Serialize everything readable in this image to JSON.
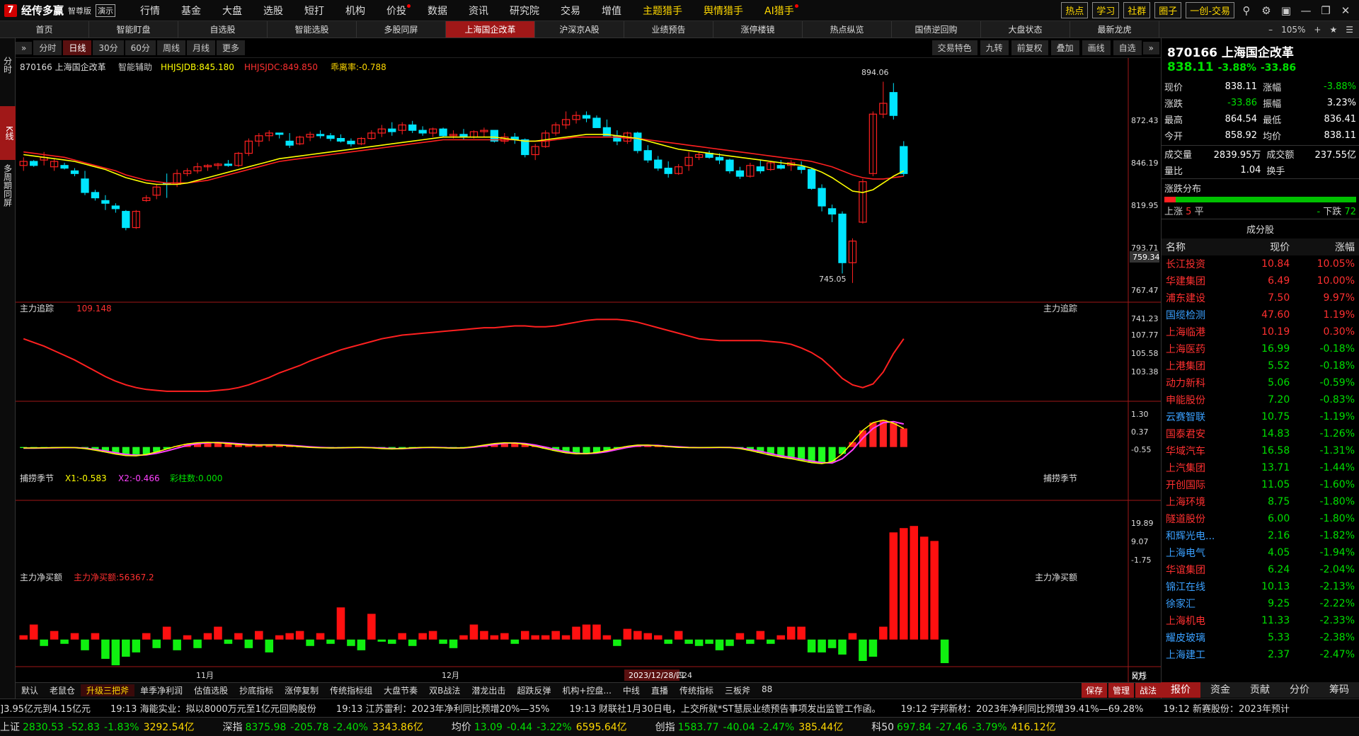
{
  "app": {
    "logo_text": "经传多赢",
    "edition": "智尊版",
    "demo_label": "演示",
    "logo_glyph": "7"
  },
  "menu": [
    {
      "label": "行情"
    },
    {
      "label": "基金"
    },
    {
      "label": "大盘"
    },
    {
      "label": "选股"
    },
    {
      "label": "短打"
    },
    {
      "label": "机构"
    },
    {
      "label": "价投",
      "dot": true
    },
    {
      "label": "数据"
    },
    {
      "label": "资讯"
    },
    {
      "label": "研究院"
    },
    {
      "label": "交易"
    },
    {
      "label": "增值"
    },
    {
      "label": "主题猎手",
      "hl": true
    },
    {
      "label": "舆情猎手",
      "hl": true
    },
    {
      "label": "AI猎手",
      "hl": true,
      "dot": true
    }
  ],
  "top_right": {
    "buttons": [
      "热点",
      "学习",
      "社群",
      "圈子",
      "一创-交易"
    ]
  },
  "tabs": [
    "首页",
    "智能盯盘",
    "自选股",
    "智能选股",
    "多股同屏",
    "上海国企改革",
    "沪深京A股",
    "业绩预告",
    "涨停楼镜",
    "热点纵览",
    "国债逆回购",
    "大盘状态",
    "最新龙虎"
  ],
  "tabs_active": "上海国企改革",
  "tabs_right": {
    "zoom": "105%"
  },
  "side_tabs": [
    "分时",
    "K线",
    "多周期同屏"
  ],
  "period_buttons": [
    "分时",
    "日线",
    "30分",
    "60分",
    "周线",
    "月线",
    "更多"
  ],
  "period_active": "日线",
  "toolbar_right": [
    "交易特色",
    "九转",
    "前复权",
    "叠加",
    "画线",
    "自选"
  ],
  "main_chart": {
    "title": "870166 上海国企改革",
    "assist": "智能辅助",
    "ind1": "HHJSJDB:845.180",
    "ind2": "HHJSJDC:849.850",
    "ind3": "乖离率:-0.788",
    "hi_label": "894.06",
    "lo_label": "745.05",
    "price_tag": "759.34",
    "yticks": [
      "872.43",
      "846.19",
      "819.95",
      "793.71",
      "767.47",
      "741.23"
    ],
    "xlabels": [
      "11月",
      "12月"
    ],
    "date_tag": "2023/12/28/四",
    "date_tail": "24",
    "period_label": "日线"
  },
  "sub1": {
    "title": "主力追踪",
    "value": "109.148",
    "right_title": "主力追踪",
    "yticks": [
      "107.77",
      "105.58",
      "103.38"
    ]
  },
  "sub2": {
    "title": "捕捞季节",
    "x1": "X1:-0.583",
    "x2": "X2:-0.466",
    "bar": "彩柱数:0.000",
    "right_title": "捕捞季节",
    "yticks": [
      "1.30",
      "0.37",
      "-0.55"
    ]
  },
  "sub3": {
    "title": "主力净买额",
    "value": "主力净买额:56367.2",
    "right_title": "主力净买额",
    "yticks": [
      "19.89",
      "9.07",
      "-1.75"
    ],
    "unit": "X万"
  },
  "chart_data": {
    "type": "candlestick",
    "ylim": [
      736,
      900
    ],
    "ohlc": [
      [
        832,
        838,
        828,
        835
      ],
      [
        835,
        836,
        831,
        832
      ],
      [
        836,
        842,
        832,
        838
      ],
      [
        831,
        837,
        828,
        835
      ],
      [
        832,
        834,
        829,
        830
      ],
      [
        828,
        830,
        824,
        826
      ],
      [
        822,
        828,
        810,
        812
      ],
      [
        812,
        814,
        806,
        808
      ],
      [
        806,
        810,
        799,
        804
      ],
      [
        802,
        804,
        797,
        800
      ],
      [
        798,
        799,
        784,
        786
      ],
      [
        786,
        799,
        785,
        798
      ],
      [
        806,
        810,
        805,
        808
      ],
      [
        810,
        818,
        807,
        816
      ],
      [
        819,
        826,
        808,
        818
      ],
      [
        818,
        829,
        816,
        826
      ],
      [
        826,
        830,
        824,
        828
      ],
      [
        828,
        834,
        826,
        831
      ],
      [
        831,
        833,
        828,
        832
      ],
      [
        832,
        834,
        829,
        833
      ],
      [
        833,
        836,
        831,
        832
      ],
      [
        832,
        842,
        831,
        841
      ],
      [
        841,
        852,
        839,
        850
      ],
      [
        850,
        856,
        846,
        854
      ],
      [
        854,
        858,
        850,
        856
      ],
      [
        856,
        856,
        852,
        855
      ],
      [
        850,
        856,
        845,
        847
      ],
      [
        848,
        854,
        847,
        853
      ],
      [
        853,
        857,
        850,
        855
      ],
      [
        855,
        858,
        852,
        854
      ],
      [
        854,
        856,
        850,
        852
      ],
      [
        852,
        855,
        849,
        850
      ],
      [
        850,
        852,
        846,
        848
      ],
      [
        848,
        853,
        847,
        852
      ],
      [
        852,
        858,
        851,
        856
      ],
      [
        856,
        862,
        853,
        859
      ],
      [
        859,
        864,
        854,
        857
      ],
      [
        858,
        864,
        855,
        862
      ],
      [
        862,
        865,
        856,
        858
      ],
      [
        858,
        861,
        854,
        856
      ],
      [
        856,
        860,
        853,
        859
      ],
      [
        859,
        860,
        853,
        854
      ],
      [
        854,
        858,
        852,
        855
      ],
      [
        855,
        859,
        851,
        853
      ],
      [
        853,
        858,
        852,
        857
      ],
      [
        857,
        860,
        853,
        858
      ],
      [
        858,
        850,
        849,
        850
      ],
      [
        850,
        856,
        848,
        853
      ],
      [
        853,
        856,
        848,
        851
      ],
      [
        851,
        852,
        838,
        840
      ],
      [
        840,
        848,
        836,
        846
      ],
      [
        846,
        858,
        845,
        856
      ],
      [
        856,
        864,
        854,
        862
      ],
      [
        862,
        872,
        859,
        866
      ],
      [
        866,
        872,
        863,
        869
      ],
      [
        869,
        872,
        864,
        867
      ],
      [
        867,
        869,
        862,
        860
      ],
      [
        860,
        866,
        856,
        854
      ],
      [
        854,
        858,
        847,
        850
      ],
      [
        850,
        857,
        848,
        856
      ],
      [
        856,
        857,
        841,
        843
      ],
      [
        843,
        847,
        834,
        836
      ],
      [
        836,
        839,
        828,
        830
      ],
      [
        830,
        835,
        823,
        826
      ],
      [
        826,
        833,
        825,
        831
      ],
      [
        832,
        842,
        828,
        838
      ],
      [
        838,
        842,
        836,
        840
      ],
      [
        841,
        843,
        837,
        838
      ],
      [
        838,
        841,
        833,
        836
      ],
      [
        836,
        837,
        826,
        828
      ],
      [
        828,
        831,
        822,
        824
      ],
      [
        824,
        834,
        823,
        832
      ],
      [
        831,
        836,
        826,
        828
      ],
      [
        829,
        835,
        828,
        834
      ],
      [
        832,
        836,
        829,
        830
      ],
      [
        832,
        836,
        828,
        834
      ],
      [
        831,
        835,
        826,
        829
      ],
      [
        829,
        830,
        814,
        815
      ],
      [
        815,
        818,
        798,
        802
      ],
      [
        800,
        803,
        790,
        796
      ],
      [
        796,
        798,
        752,
        760
      ],
      [
        760,
        778,
        745,
        776
      ],
      [
        790,
        822,
        789,
        820
      ],
      [
        826,
        872,
        824,
        870
      ],
      [
        870,
        894,
        867,
        878
      ],
      [
        886,
        893,
        866,
        869
      ],
      [
        846,
        850,
        824,
        826
      ]
    ],
    "ma_yellow": [
      840,
      839,
      838,
      837,
      836,
      835,
      833,
      831,
      829,
      826,
      823,
      821,
      819,
      818,
      818,
      818,
      819,
      821,
      823,
      825,
      827,
      829,
      831,
      833,
      835,
      837,
      838,
      839,
      840,
      841,
      842,
      843,
      844,
      845,
      846,
      847,
      848,
      849,
      850,
      851,
      852,
      853,
      853,
      853,
      853,
      853,
      853,
      852,
      851,
      850,
      850,
      851,
      852,
      853,
      854,
      855,
      855,
      855,
      854,
      853,
      852,
      850,
      848,
      846,
      844,
      843,
      842,
      841,
      840,
      839,
      838,
      837,
      836,
      835,
      834,
      833,
      832,
      830,
      827,
      823,
      818,
      813,
      812,
      814,
      819,
      824,
      828
    ],
    "ma_red": [
      842,
      841,
      840,
      839,
      838,
      836,
      834,
      832,
      830,
      828,
      825,
      823,
      821,
      820,
      819,
      819,
      819,
      820,
      821,
      823,
      825,
      827,
      829,
      831,
      833,
      835,
      836,
      837,
      838,
      839,
      840,
      841,
      842,
      843,
      844,
      845,
      846,
      847,
      848,
      849,
      850,
      851,
      851,
      851,
      851,
      851,
      851,
      851,
      851,
      850,
      850,
      850,
      851,
      852,
      853,
      853,
      853,
      853,
      853,
      852,
      852,
      851,
      850,
      849,
      848,
      847,
      846,
      845,
      844,
      843,
      842,
      841,
      840,
      839,
      838,
      837,
      836,
      835,
      833,
      831,
      828,
      825,
      823,
      822,
      822,
      823,
      824
    ],
    "zhuli_ylim": [
      101.5,
      109.8
    ],
    "zhuli": [
      107.9,
      107.5,
      107.1,
      106.6,
      106.1,
      105.6,
      105.0,
      104.4,
      103.8,
      103.3,
      102.9,
      102.6,
      102.4,
      102.3,
      102.2,
      102.2,
      102.2,
      102.2,
      102.2,
      102.3,
      102.4,
      102.6,
      102.9,
      103.3,
      103.7,
      104.2,
      104.6,
      105.0,
      105.5,
      105.9,
      106.3,
      106.7,
      107.0,
      107.3,
      107.6,
      107.9,
      108.1,
      108.3,
      108.4,
      108.5,
      108.6,
      108.7,
      108.8,
      108.9,
      109.0,
      109.1,
      109.1,
      109.2,
      109.3,
      109.3,
      109.2,
      109.2,
      109.3,
      109.5,
      109.7,
      109.9,
      110.0,
      110.0,
      110.0,
      109.9,
      109.7,
      109.4,
      109.1,
      108.8,
      108.5,
      108.2,
      107.9,
      107.8,
      107.7,
      107.7,
      107.7,
      107.7,
      107.7,
      107.6,
      107.5,
      107.3,
      106.9,
      106.4,
      105.7,
      104.7,
      103.6,
      102.9,
      102.6,
      103.0,
      104.3,
      106.3,
      107.9
    ],
    "buolao_ylim": [
      -1.1,
      1.8
    ],
    "buolao_x1": [
      -0.05,
      -0.05,
      -0.04,
      -0.03,
      -0.02,
      -0.03,
      -0.08,
      -0.16,
      -0.26,
      -0.36,
      -0.44,
      -0.45,
      -0.38,
      -0.25,
      -0.1,
      0.05,
      0.16,
      0.22,
      0.24,
      0.22,
      0.18,
      0.13,
      0.1,
      0.1,
      0.11,
      0.1,
      0.06,
      0.02,
      -0.02,
      -0.04,
      -0.05,
      -0.04,
      -0.02,
      -0.02,
      -0.04,
      -0.08,
      -0.1,
      -0.08,
      -0.04,
      -0.02,
      -0.02,
      -0.04,
      -0.06,
      -0.04,
      0.02,
      0.1,
      0.18,
      0.22,
      0.2,
      0.14,
      0.04,
      -0.08,
      -0.2,
      -0.3,
      -0.35,
      -0.34,
      -0.28,
      -0.18,
      -0.06,
      0.04,
      0.1,
      0.1,
      0.06,
      0.02,
      -0.02,
      -0.03,
      -0.03,
      -0.02,
      -0.02,
      -0.03,
      -0.08,
      -0.18,
      -0.3,
      -0.42,
      -0.52,
      -0.6,
      -0.7,
      -0.8,
      -0.85,
      -0.75,
      -0.35,
      0.25,
      0.85,
      1.25,
      1.38,
      1.22,
      0.95
    ],
    "buolao_x2": [
      -0.06,
      -0.06,
      -0.05,
      -0.04,
      -0.03,
      -0.03,
      -0.06,
      -0.12,
      -0.2,
      -0.3,
      -0.38,
      -0.42,
      -0.4,
      -0.32,
      -0.2,
      -0.06,
      0.08,
      0.17,
      0.22,
      0.23,
      0.21,
      0.17,
      0.13,
      0.11,
      0.11,
      0.11,
      0.09,
      0.05,
      0.01,
      -0.02,
      -0.04,
      -0.04,
      -0.03,
      -0.02,
      -0.03,
      -0.05,
      -0.08,
      -0.08,
      -0.06,
      -0.03,
      -0.02,
      -0.03,
      -0.05,
      -0.05,
      -0.01,
      0.05,
      0.13,
      0.19,
      0.21,
      0.18,
      0.1,
      -0.01,
      -0.13,
      -0.24,
      -0.32,
      -0.34,
      -0.31,
      -0.24,
      -0.13,
      -0.02,
      0.06,
      0.09,
      0.08,
      0.04,
      0.01,
      -0.02,
      -0.03,
      -0.03,
      -0.02,
      -0.02,
      -0.05,
      -0.12,
      -0.22,
      -0.34,
      -0.45,
      -0.53,
      -0.62,
      -0.72,
      -0.8,
      -0.82,
      -0.6,
      -0.15,
      0.45,
      0.95,
      1.25,
      1.3,
      1.18
    ],
    "jinmai_ylim": [
      -5,
      30
    ],
    "jinmai": [
      1,
      3.5,
      -1.5,
      2,
      -1,
      1.5,
      -2.5,
      1.5,
      -4.5,
      -6,
      -4,
      -3,
      1.5,
      -2,
      3,
      -2.5,
      1,
      -2,
      1.5,
      3,
      -1,
      1.5,
      -2,
      2,
      -3,
      1,
      1.5,
      2,
      -1.5,
      1.5,
      -1,
      7.5,
      -1.5,
      -2.5,
      6,
      -0.5,
      -1,
      1.5,
      -1.5,
      1.5,
      2,
      -1,
      -2,
      1,
      3.5,
      2,
      1,
      1.5,
      -1,
      2,
      1,
      1,
      2,
      1,
      3,
      3.5,
      3.5,
      1,
      -1.5,
      2.5,
      2,
      1.5,
      1,
      -1,
      2,
      -1,
      -1.5,
      -1,
      -2.5,
      -1.5,
      1.5,
      -1,
      2,
      -1,
      1,
      3,
      3,
      -3,
      -3,
      -2,
      -3.5,
      1.5,
      -5,
      -4,
      3,
      25,
      26,
      26.5,
      24,
      23,
      -5.5
    ]
  },
  "stock": {
    "title": "870166 上海国企改革",
    "price": "838.11",
    "chg_pct": "-3.88%",
    "chg": "-33.86",
    "rows": [
      [
        "现价",
        "838.11",
        "涨幅",
        "-3.88%"
      ],
      [
        "涨跌",
        "-33.86",
        "振幅",
        "3.23%"
      ],
      [
        "最高",
        "864.54",
        "最低",
        "836.41"
      ],
      [
        "今开",
        "858.92",
        "均价",
        "838.11"
      ]
    ],
    "rows2": [
      [
        "成交量",
        "2839.95万",
        "成交额",
        "237.55亿"
      ],
      [
        "量比",
        "1.04",
        "换手",
        ""
      ]
    ]
  },
  "dist": {
    "title": "涨跌分布",
    "up_label": "上涨",
    "up": "5",
    "flat_label": "平",
    "flat": "-",
    "down_label": "下跌",
    "down": "72"
  },
  "constituents": {
    "title": "成分股",
    "headers": [
      "名称",
      "现价",
      "涨幅"
    ],
    "rows": [
      [
        "长江投资",
        "10.84",
        "10.05%"
      ],
      [
        "华建集团",
        "6.49",
        "10.00%"
      ],
      [
        "浦东建设",
        "7.50",
        "9.97%"
      ],
      [
        "国缆检测",
        "47.60",
        "1.19%"
      ],
      [
        "上海临港",
        "10.19",
        "0.30%"
      ],
      [
        "上海医药",
        "16.99",
        "-0.18%"
      ],
      [
        "上港集团",
        "5.52",
        "-0.18%"
      ],
      [
        "动力新科",
        "5.06",
        "-0.59%"
      ],
      [
        "申能股份",
        "7.20",
        "-0.83%"
      ],
      [
        "云赛智联",
        "10.75",
        "-1.19%"
      ],
      [
        "国泰君安",
        "14.83",
        "-1.26%"
      ],
      [
        "华域汽车",
        "16.58",
        "-1.31%"
      ],
      [
        "上汽集团",
        "13.71",
        "-1.44%"
      ],
      [
        "开创国际",
        "11.05",
        "-1.60%"
      ],
      [
        "上海环境",
        "8.75",
        "-1.80%"
      ],
      [
        "隧道股份",
        "6.00",
        "-1.80%"
      ],
      [
        "和辉光电...",
        "2.16",
        "-1.82%"
      ],
      [
        "上海电气",
        "4.05",
        "-1.94%"
      ],
      [
        "华谊集团",
        "6.24",
        "-2.04%"
      ],
      [
        "锦江在线",
        "10.13",
        "-2.13%"
      ],
      [
        "徐家汇",
        "9.25",
        "-2.22%"
      ],
      [
        "上海机电",
        "11.33",
        "-2.33%"
      ],
      [
        "耀皮玻璃",
        "5.33",
        "-2.38%"
      ],
      [
        "上海建工",
        "2.37",
        "-2.47%"
      ]
    ]
  },
  "right_tabs": [
    "报价",
    "资金",
    "贡献",
    "分价",
    "筹码"
  ],
  "bottom_tabs": [
    "默认",
    "老鼠仓",
    "升级三把斧",
    "单季净利润",
    "估值选股",
    "抄底指标",
    "涨停复制",
    "传统指标组",
    "大盘节奏",
    "双B战法",
    "潜龙出击",
    "超跌反弹",
    "机构+控盘...",
    "中线",
    "直播",
    "传统指标",
    "三板斧",
    "88"
  ],
  "bottom_active": "升级三把斧",
  "bottom_right": [
    "保存",
    "管理",
    "战法"
  ],
  "ticker": [
    "]3.95亿元到4.15亿元",
    "19:13 海能实业：拟以8000万元至1亿元回购股份",
    "19:13 江苏雷利：2023年净利同比预增20%—35%",
    "19:13 财联社1月30日电，上交所就*ST慧辰业绩预告事项发出监管工作函。",
    "19:12 宇邦新材：2023年净利同比预增39.41%—69.28%",
    "19:12 新赛股份：2023年预计"
  ],
  "indices": [
    {
      "name": "上证",
      "val": "2830.53",
      "chg": "-52.83",
      "pct": "-1.83%",
      "amt": "3292.54亿"
    },
    {
      "name": "深指",
      "val": "8375.98",
      "chg": "-205.78",
      "pct": "-2.40%",
      "amt": "3343.86亿"
    },
    {
      "name": "均价",
      "val": "13.09",
      "chg": "-0.44",
      "pct": "-3.22%",
      "amt": "6595.64亿"
    },
    {
      "name": "创指",
      "val": "1583.77",
      "chg": "-40.04",
      "pct": "-2.47%",
      "amt": "385.44亿"
    },
    {
      "name": "科50",
      "val": "697.84",
      "chg": "-27.46",
      "pct": "-3.79%",
      "amt": "416.12亿"
    }
  ],
  "colors": {
    "up": "#ff2020",
    "down": "#00e5ff",
    "ma_yellow": "#ffff00",
    "ma_red": "#ff2020",
    "accent": "#a01818"
  }
}
